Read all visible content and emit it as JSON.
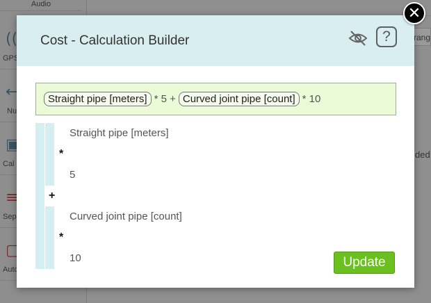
{
  "background": {
    "audio_label": "Audio",
    "tools": [
      {
        "glyph": "((·",
        "label": "GPS N"
      },
      {
        "glyph": "←",
        "label": "Nu"
      },
      {
        "glyph": "▣",
        "label": "Cal"
      },
      {
        "glyph": "≡",
        "label": "Sep"
      },
      {
        "glyph": "▢",
        "label": "Auto"
      }
    ],
    "right_fragment": "rang",
    "right_text_fragment": "ded"
  },
  "modal": {
    "title": "Cost - Calculation Builder",
    "hide_icon": "eye-slash-icon",
    "help_label": "?",
    "close_label": "✕"
  },
  "formula": {
    "chip_1": "Straight pipe [meters]",
    "op_1": "* 5 +",
    "chip_2": "Curved joint pipe [count]",
    "op_2": "* 10"
  },
  "builder": {
    "rows": [
      {
        "kind": "field",
        "text": "Straight pipe [meters]"
      },
      {
        "kind": "op",
        "text": "*"
      },
      {
        "kind": "value",
        "text": "5"
      },
      {
        "kind": "op",
        "text": "+"
      },
      {
        "kind": "field",
        "text": "Curved joint pipe [count]"
      },
      {
        "kind": "op",
        "text": "*"
      },
      {
        "kind": "value",
        "text": "10"
      }
    ],
    "update_label": "Update"
  },
  "colors": {
    "header_bg": "#d9eef1",
    "formula_bg": "#ebfad7",
    "formula_border": "#8ac64c",
    "update_bg": "#6bbf1e"
  }
}
